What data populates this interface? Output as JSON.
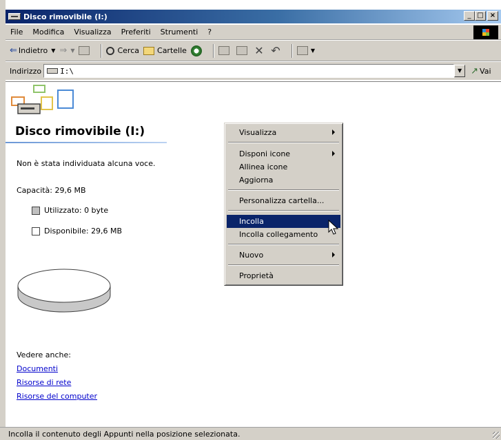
{
  "window": {
    "title": "Disco rimovibile (I:)",
    "minimize": "_",
    "maximize": "□",
    "close": "×"
  },
  "menubar": [
    "File",
    "Modifica",
    "Visualizza",
    "Preferiti",
    "Strumenti",
    "?"
  ],
  "toolbar": {
    "back_label": "Indietro",
    "search_label": "Cerca",
    "folders_label": "Cartelle"
  },
  "address": {
    "label": "Indirizzo",
    "value": "I:\\",
    "go_label": "Vai"
  },
  "panel": {
    "heading": "Disco rimovibile (I:)",
    "note": "Non è stata individuata alcuna voce.",
    "capacity": "Capacità: 29,6 MB",
    "used": "Utilizzato: 0 byte",
    "free": "Disponibile: 29,6 MB",
    "used_color": "#c0c0c0",
    "free_color": "#ffffff",
    "see_also": "Vedere anche:",
    "links": [
      "Documenti",
      "Risorse di rete",
      "Risorse del computer"
    ]
  },
  "context_menu": {
    "items": [
      {
        "label": "Visualizza",
        "submenu": true
      },
      {
        "label": "Disponi icone",
        "submenu": true
      },
      {
        "label": "Allinea icone",
        "submenu": false
      },
      {
        "label": "Aggiorna",
        "submenu": false
      },
      {
        "label": "Personalizza cartella...",
        "submenu": false
      },
      {
        "label": "Incolla",
        "submenu": false,
        "selected": true
      },
      {
        "label": "Incolla collegamento",
        "submenu": false
      },
      {
        "label": "Nuovo",
        "submenu": true
      },
      {
        "label": "Proprietà",
        "submenu": false
      }
    ]
  },
  "statusbar": {
    "text": "Incolla il contenuto degli Appunti nella posizione selezionata."
  },
  "colors": {
    "titlebar_start": "#0a246a",
    "titlebar_end": "#a6caf0",
    "menu_highlight": "#0a246a",
    "chrome": "#d4d0c8",
    "link": "#0000cc"
  }
}
